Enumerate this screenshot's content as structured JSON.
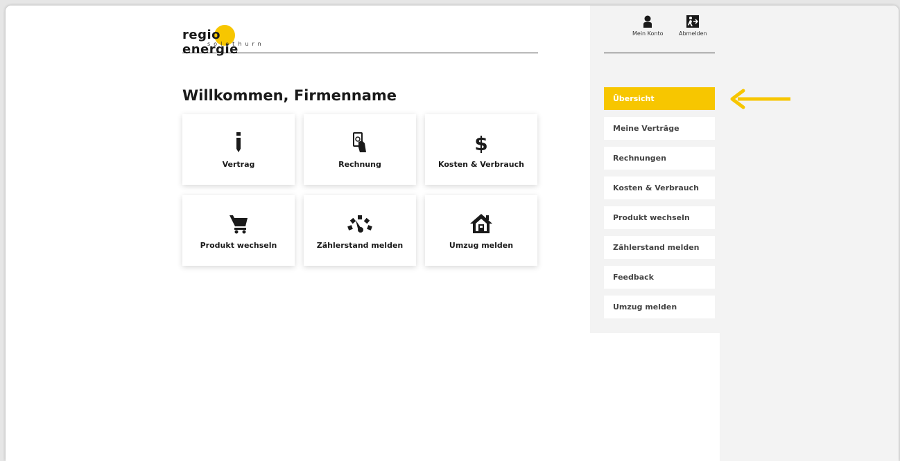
{
  "colors": {
    "accent": "#f7c600",
    "text": "#1a1a1a",
    "sidebar_bg": "#f3f3f3"
  },
  "brand": {
    "name": "regio energie",
    "subtitle": "solothurn"
  },
  "header": {
    "account": {
      "label": "Mein Konto",
      "icon": "user-icon"
    },
    "logout": {
      "label": "Abmelden",
      "icon": "exit-icon"
    }
  },
  "main": {
    "title": "Willkommen, Firmenname",
    "tiles": [
      {
        "label": "Vertrag",
        "icon": "info-icon"
      },
      {
        "label": "Rechnung",
        "icon": "bill-icon"
      },
      {
        "label": "Kosten & Verbrauch",
        "icon": "dollar-icon"
      },
      {
        "label": "Produkt wechseln",
        "icon": "cart-icon"
      },
      {
        "label": "Zählerstand melden",
        "icon": "gauge-icon"
      },
      {
        "label": "Umzug melden",
        "icon": "house-icon"
      }
    ]
  },
  "sidebar": {
    "items": [
      {
        "label": "Übersicht",
        "active": true
      },
      {
        "label": "Meine Verträge"
      },
      {
        "label": "Rechnungen"
      },
      {
        "label": "Kosten & Verbrauch"
      },
      {
        "label": "Produkt wechseln"
      },
      {
        "label": "Zählerstand melden"
      },
      {
        "label": "Feedback"
      },
      {
        "label": "Umzug melden"
      }
    ]
  },
  "annotation": {
    "icon": "arrow-left-icon"
  }
}
